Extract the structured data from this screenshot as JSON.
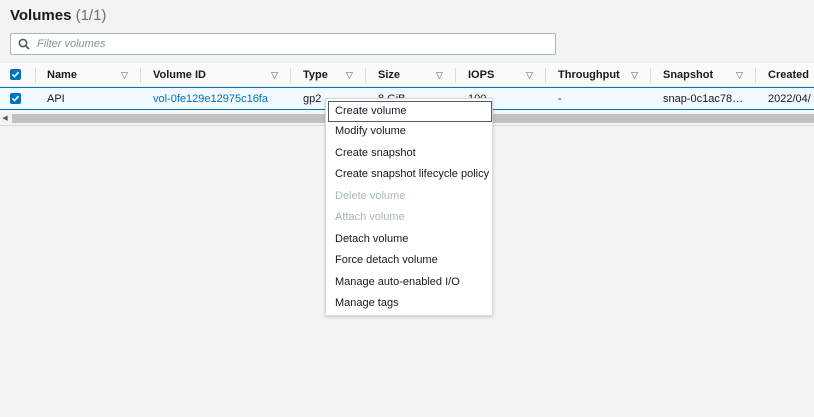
{
  "header": {
    "title": "Volumes",
    "count": "(1/1)"
  },
  "filter": {
    "placeholder": "Filter volumes"
  },
  "columns": {
    "name": "Name",
    "volume_id": "Volume ID",
    "type": "Type",
    "size": "Size",
    "iops": "IOPS",
    "throughput": "Throughput",
    "snapshot": "Snapshot",
    "created": "Created"
  },
  "rows": [
    {
      "name": "API",
      "volume_id": "vol-0fe129e12975c16fa",
      "type": "gp2",
      "size": "8 GiB",
      "iops": "100",
      "throughput": "-",
      "snapshot": "snap-0c1ac78…",
      "created": "2022/04/"
    }
  ],
  "context_menu": {
    "items": [
      {
        "label": "Create volume",
        "enabled": true
      },
      {
        "label": "Modify volume",
        "enabled": true
      },
      {
        "label": "Create snapshot",
        "enabled": true
      },
      {
        "label": "Create snapshot lifecycle policy",
        "enabled": true
      },
      {
        "label": "Delete volume",
        "enabled": false
      },
      {
        "label": "Attach volume",
        "enabled": false
      },
      {
        "label": "Detach volume",
        "enabled": true
      },
      {
        "label": "Force detach volume",
        "enabled": true
      },
      {
        "label": "Manage auto-enabled I/O",
        "enabled": true
      },
      {
        "label": "Manage tags",
        "enabled": true
      }
    ]
  },
  "colors": {
    "accent": "#0073bb",
    "disabled_text": "#aab7b8",
    "background": "#f2f3f3"
  }
}
